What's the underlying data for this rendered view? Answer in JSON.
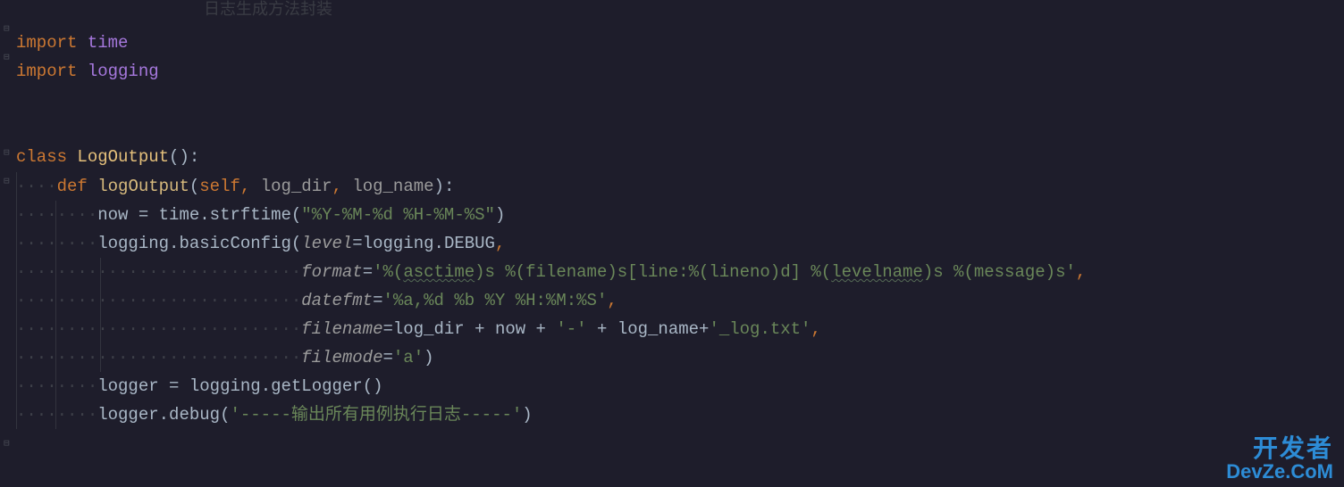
{
  "faded_header": "日志生成方法封装",
  "code": {
    "import_kw": "import",
    "time_mod": "time",
    "logging_mod": "logging",
    "class_kw": "class",
    "class_name": "LogOutput",
    "def_kw": "def",
    "method_name": "logOutput",
    "self_kw": "self",
    "param_log_dir": "log_dir",
    "param_log_name": "log_name",
    "now_var": "now",
    "strftime_call": "strftime",
    "strftime_fmt": "\"%Y-%M-%d %H-%M-%S\"",
    "basicConfig_call": "basicConfig",
    "level_kwarg": "level",
    "DEBUG_attr": "DEBUG",
    "format_kwarg": "format",
    "format_str_full": "'%(asctime)s %(filename)s[line:%(lineno)d] %(levelname)s %(message)s'",
    "format_seg": {
      "q1": "'%(",
      "asctime": "asctime",
      "s1": ")s %(filename)s[line:%(lineno)d] %(",
      "levelname": "levelname",
      "s2": ")s %(message)s'"
    },
    "datefmt_kwarg": "datefmt",
    "datefmt_str": "'%a,%d %b %Y %H:%M:%S'",
    "filename_kwarg": "filename",
    "plus": " + ",
    "dash_str": "'-'",
    "log_suffix_str": "'_log.txt'",
    "filemode_kwarg": "filemode",
    "filemode_str": "'a'",
    "logger_var": "logger",
    "getLogger_call": "getLogger",
    "debug_call": "debug",
    "debug_str": "'-----输出所有用例执行日志-----'",
    "dots4": "····",
    "dots8": "········",
    "dots28": "····························"
  },
  "watermark": {
    "line1": "开发者",
    "line2": "DevZe.CoM"
  }
}
